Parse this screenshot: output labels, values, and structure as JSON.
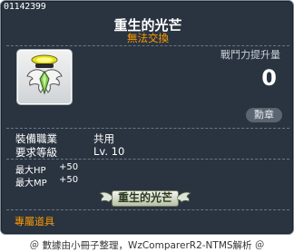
{
  "tooltip": {
    "item_id": "01142399",
    "item_name": "重生的光芒",
    "trade_status": "無法交換",
    "combat_power": {
      "label": "戰鬥力提升量",
      "value": "0"
    },
    "medal_button": "勳章",
    "stats": {
      "job_label": "裝備職業",
      "job_value": "共用",
      "level_label": "要求等級",
      "level_value": "Lv. 10",
      "hp_label": "最大HP",
      "hp_value": "+50",
      "mp_label": "最大MP",
      "mp_value": "+50"
    },
    "title_badge": "重生的光芒",
    "category": "專屬道具"
  },
  "footer": "＠ 數據由小冊子整理，WzComparerR2-NTMS解析 ＠",
  "colors": {
    "background": "#2a3440",
    "accent_orange": "#ff9a00",
    "text_white": "#ffffff"
  }
}
